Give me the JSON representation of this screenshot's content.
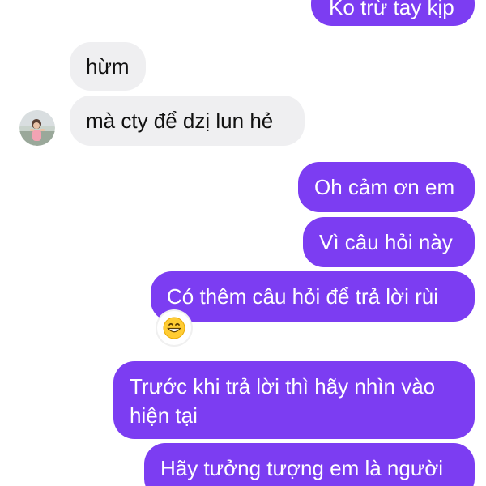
{
  "conversation": {
    "messages": [
      {
        "id": "m0",
        "direction": "outgoing",
        "text": "Ko trừ tay kịp"
      },
      {
        "id": "m1",
        "direction": "incoming",
        "text": "hừm"
      },
      {
        "id": "m2",
        "direction": "incoming",
        "text": "mà cty để dzị lun hẻ"
      },
      {
        "id": "m3",
        "direction": "outgoing",
        "text": "Oh cảm ơn em"
      },
      {
        "id": "m4",
        "direction": "outgoing",
        "text": "Vì câu hỏi này"
      },
      {
        "id": "m5",
        "direction": "outgoing",
        "text": "Có thêm câu hỏi để trả lời rùi",
        "reaction": "grinning-face-emoji"
      },
      {
        "id": "m6",
        "direction": "outgoing",
        "text": "Trước khi trả lời thì hãy nhìn vào hiện tại"
      },
      {
        "id": "m7",
        "direction": "outgoing",
        "text": "Hãy tưởng tượng em là người"
      }
    ]
  },
  "colors": {
    "outgoing_bubble": "#7c3df2",
    "incoming_bubble": "#efeff1",
    "outgoing_text": "#ffffff",
    "incoming_text": "#111111"
  }
}
